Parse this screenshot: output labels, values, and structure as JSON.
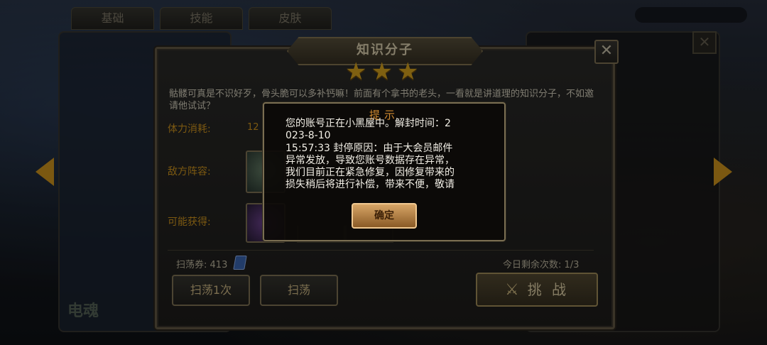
{
  "background": {
    "tabs": [
      "基础",
      "技能",
      "皮肤"
    ],
    "side_label": "电魂"
  },
  "panel": {
    "title": "知识分子",
    "stars": 3,
    "close_label": "✕",
    "description": "骷髅可真是不识好歹，骨头脆可以多补钙嘛！前面有个拿书的老头，一看就是讲道理的知识分子，不如邀请他试试？",
    "stamina_label": "体力消耗:",
    "stamina_value": "12",
    "enemy_label": "敌方阵容:",
    "reward_label": "可能获得:",
    "sweep_ticket_label": "扫荡券:",
    "sweep_ticket_count": "413",
    "remain_label": "今日剩余次数:",
    "remain_value": "1/3",
    "btn_sweep1": "扫荡1次",
    "btn_sweep": "扫荡",
    "btn_challenge": "挑 战"
  },
  "dialog": {
    "title": "提示",
    "message": "您的账号正在小黑屋中。解封时间：2\n023-8-10\n15:57:33 封停原因：由于大会员邮件\n异常发放，导致您账号数据存在异常，\n我们目前正在紧急修复，因修复带来的\n损失稍后将进行补偿，带来不便，敬请",
    "ok_label": "确定"
  }
}
